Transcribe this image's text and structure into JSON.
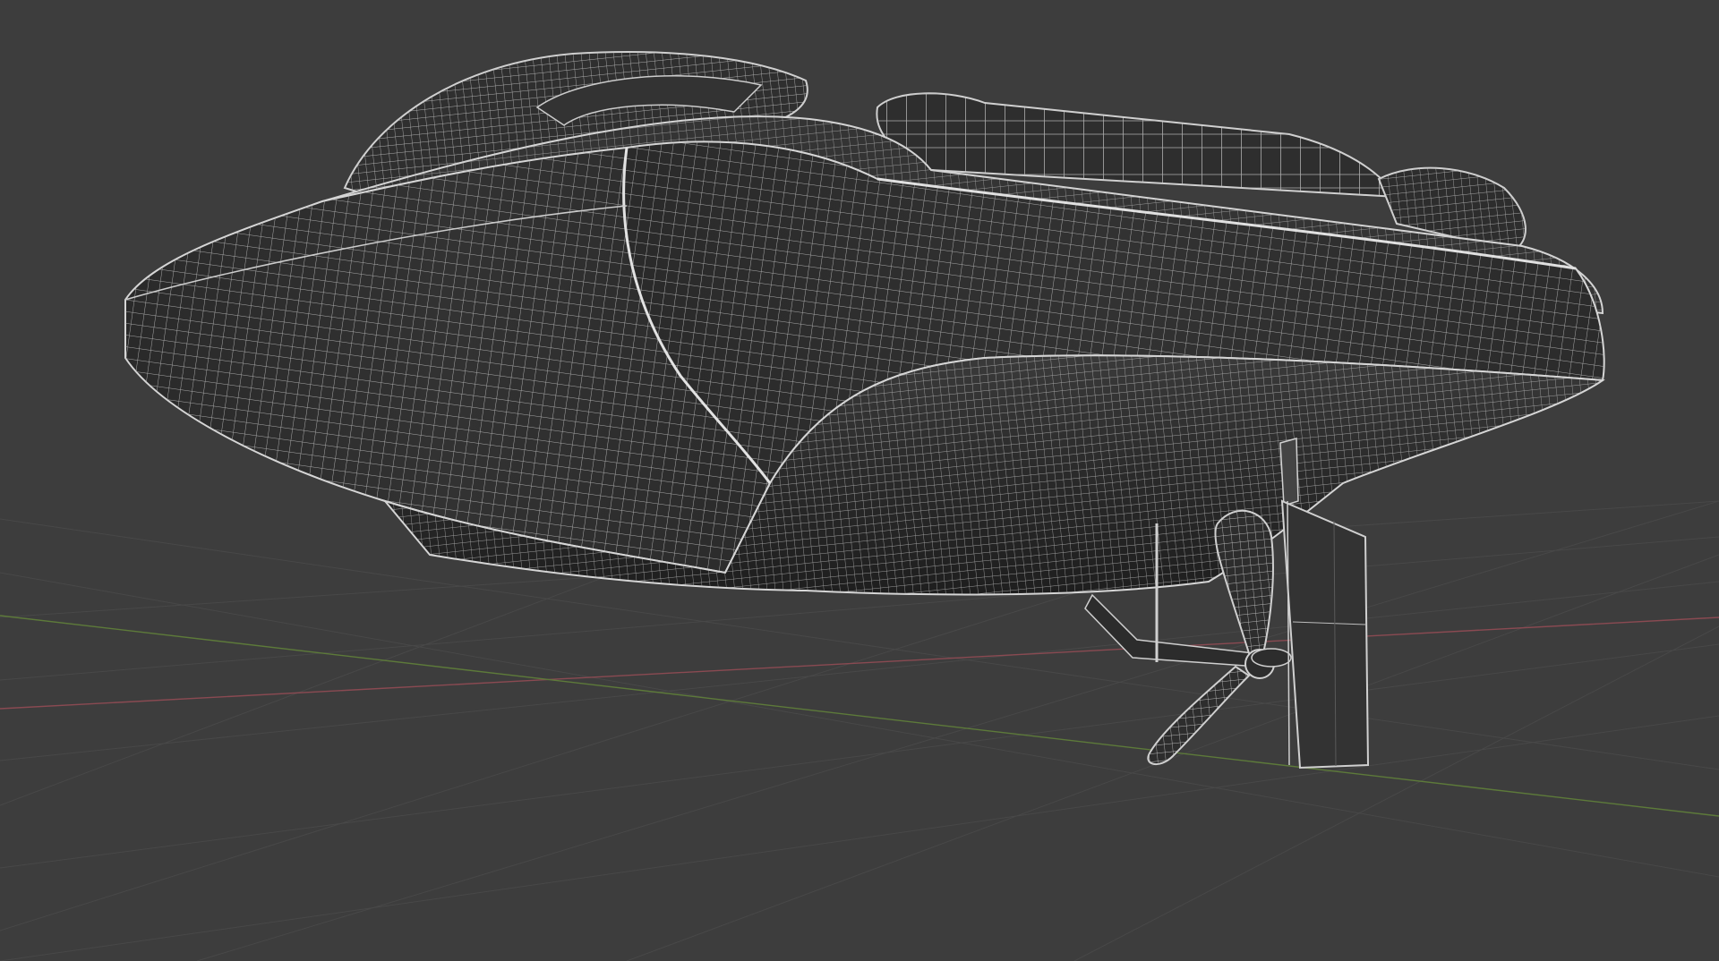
{
  "scene": {
    "background_color": "#3d3d3d",
    "grid_color": "#4a4a4a",
    "x_axis_color": "#8a4a52",
    "y_axis_color": "#5d7a3a",
    "wire_color": "#c9c9c9",
    "hull_fill_color": "#262626",
    "rudder_fill_color": "#333333"
  }
}
